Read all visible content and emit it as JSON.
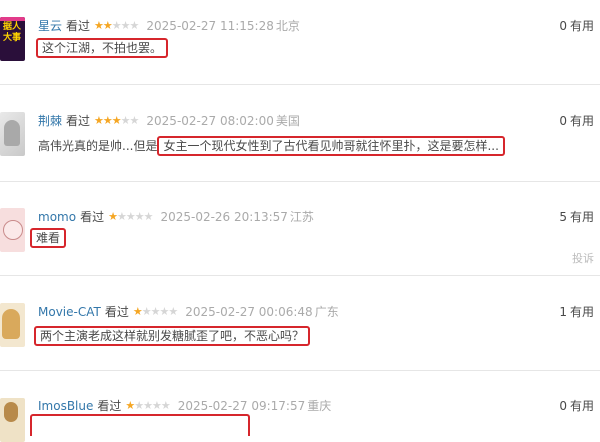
{
  "comments": [
    {
      "user": "星云",
      "watched": "看过",
      "stars": 2,
      "time": "2025-02-27 11:15:28",
      "location": "北京",
      "votes": "0",
      "votes_label": "有用",
      "text_plain": "",
      "text_highlight": "这个江湖，不拍也罢。",
      "avatar_text": [
        "据人",
        "大事"
      ]
    },
    {
      "user": "荆棘",
      "watched": "看过",
      "stars": 3,
      "time": "2025-02-27 08:02:00",
      "location": "美国",
      "votes": "0",
      "votes_label": "有用",
      "text_plain": "高伟光真的是帅...但是",
      "text_highlight": "女主一个现代女性到了古代看见帅哥就往怀里扑，这是要怎样..."
    },
    {
      "user": "momo",
      "watched": "看过",
      "stars": 1,
      "time": "2025-02-26 20:13:57",
      "location": "江苏",
      "votes": "5",
      "votes_label": "有用",
      "report": "投诉",
      "text_plain": "",
      "text_highlight": "难看"
    },
    {
      "user": "Movie-CAT",
      "watched": "看过",
      "stars": 1,
      "time": "2025-02-27 00:06:48",
      "location": "广东",
      "votes": "1",
      "votes_label": "有用",
      "text_plain": "",
      "text_highlight": "两个主演老成这样就别发糖腻歪了吧，不恶心吗？"
    },
    {
      "user": "ImosBlue",
      "watched": "看过",
      "stars": 1,
      "time": "2025-02-27 09:17:57",
      "location": "重庆",
      "votes": "0",
      "votes_label": "有用"
    }
  ],
  "colors": {
    "username": "#3377aa",
    "star_on": "#f5a623",
    "star_off": "#d6d6d6",
    "highlight_box": "#d6262c",
    "meta_gray": "#aaaaaa"
  }
}
